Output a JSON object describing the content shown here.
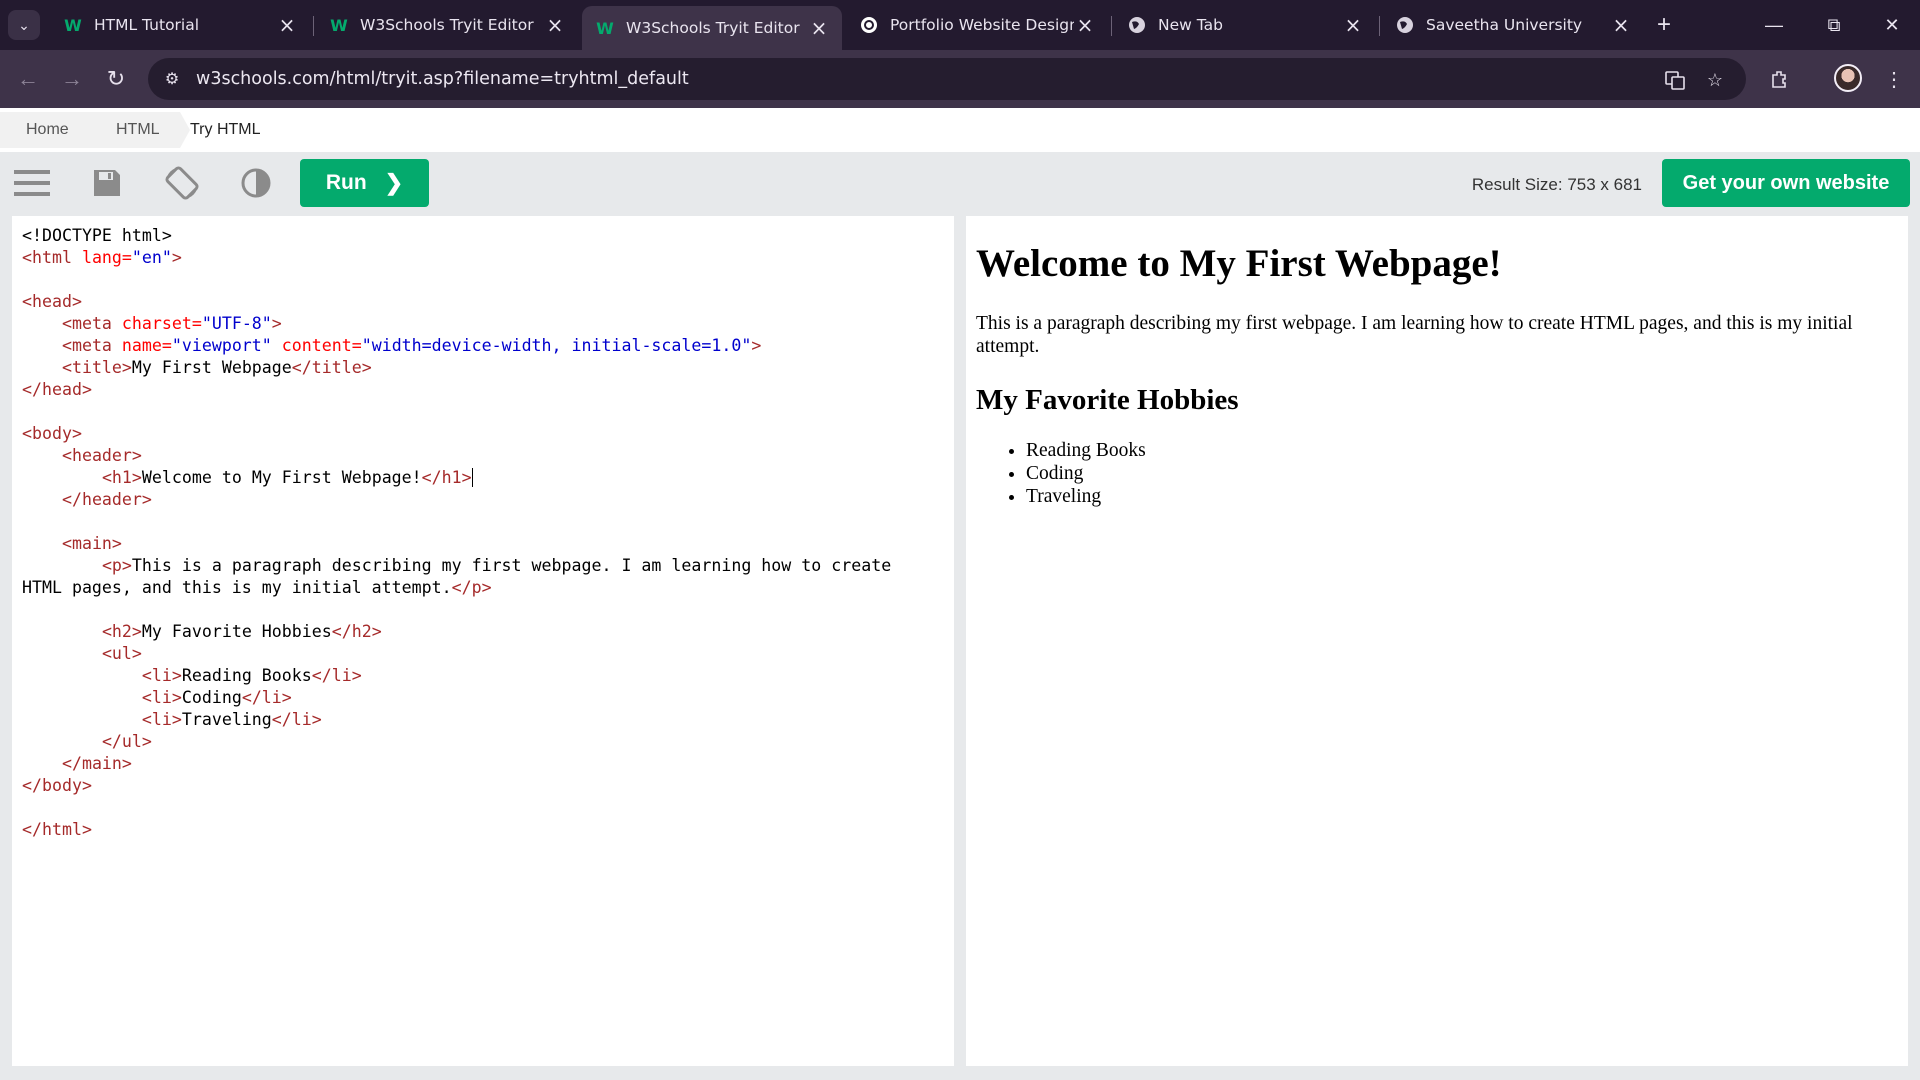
{
  "browser": {
    "tabs": [
      {
        "label": "HTML Tutorial",
        "icon": "w3schools-icon",
        "active": false
      },
      {
        "label": "W3Schools Tryit Editor",
        "icon": "w3schools-icon",
        "active": false
      },
      {
        "label": "W3Schools Tryit Editor",
        "icon": "w3schools-icon",
        "active": true
      },
      {
        "label": "Portfolio Website Design",
        "icon": "chatgpt-icon",
        "active": false
      },
      {
        "label": "New Tab",
        "icon": "globe-icon",
        "active": false
      },
      {
        "label": "Saveetha University",
        "icon": "globe-icon",
        "active": false
      }
    ],
    "url": "w3schools.com/html/tryit.asp?filename=tryhtml_default",
    "accent": "#3e3349",
    "tabstrip_bg": "#231a2f"
  },
  "breadcrumb": {
    "items": [
      "Home",
      "HTML",
      "Try HTML"
    ]
  },
  "tryit": {
    "run_label": "Run",
    "result_size_label": "Result Size: 753 x 681",
    "get_website_label": "Get your own website",
    "brand_color": "#04aa6d"
  },
  "editor": {
    "lines": [
      "<!DOCTYPE html>",
      "<html lang=\"en\">",
      "",
      "<head>",
      "    <meta charset=\"UTF-8\">",
      "    <meta name=\"viewport\" content=\"width=device-width, initial-scale=1.0\">",
      "    <title>My First Webpage</title>",
      "</head>",
      "",
      "<body>",
      "    <header>",
      "        <h1>Welcome to My First Webpage!</h1>",
      "    </header>",
      "",
      "    <main>",
      "        <p>This is a paragraph describing my first webpage. I am learning how to create",
      "HTML pages, and this is my initial attempt.</p>",
      "",
      "        <h2>My Favorite Hobbies</h2>",
      "        <ul>",
      "            <li>Reading Books</li>",
      "            <li>Coding</li>",
      "            <li>Traveling</li>",
      "        </ul>",
      "    </main>",
      "</body>",
      "",
      "</html>"
    ]
  },
  "result": {
    "h1": "Welcome to My First Webpage!",
    "paragraph": "This is a paragraph describing my first webpage. I am learning how to create HTML pages, and this is my initial attempt.",
    "h2": "My Favorite Hobbies",
    "list": [
      "Reading Books",
      "Coding",
      "Traveling"
    ]
  }
}
